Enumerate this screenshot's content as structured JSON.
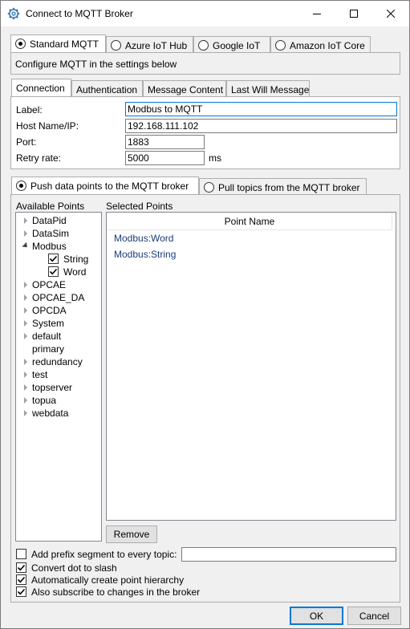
{
  "window": {
    "title": "Connect to MQTT Broker",
    "icon": "gear-icon",
    "controls": [
      "minimize-icon",
      "maximize-icon",
      "close-icon"
    ]
  },
  "broker_tabs": [
    {
      "label": "Standard MQTT",
      "selected": true
    },
    {
      "label": "Azure IoT Hub",
      "selected": false
    },
    {
      "label": "Google IoT",
      "selected": false
    },
    {
      "label": "Amazon IoT Core",
      "selected": false
    }
  ],
  "broker_description": "Configure MQTT in the settings below",
  "settings_tabs": [
    {
      "label": "Connection",
      "active": true
    },
    {
      "label": "Authentication",
      "active": false
    },
    {
      "label": "Message Content",
      "active": false
    },
    {
      "label": "Last Will Message",
      "active": false
    }
  ],
  "connection": {
    "label_caption": "Label:",
    "label_value": "Modbus to MQTT",
    "host_caption": "Host Name/IP:",
    "host_value": "192.168.111.102",
    "port_caption": "Port:",
    "port_value": "1883",
    "retry_caption": "Retry rate:",
    "retry_value": "5000",
    "retry_unit": "ms"
  },
  "direction_tabs": [
    {
      "label": "Push data points to the MQTT broker",
      "selected": true
    },
    {
      "label": "Pull topics from the MQTT broker",
      "selected": false
    }
  ],
  "available_points": {
    "title": "Available Points",
    "tree": [
      {
        "label": "DataPid",
        "expandable": true
      },
      {
        "label": "DataSim",
        "expandable": true
      },
      {
        "label": "Modbus",
        "expanded": true,
        "children": [
          {
            "label": "String",
            "checked": true
          },
          {
            "label": "Word",
            "checked": true
          }
        ]
      },
      {
        "label": "OPCAE",
        "expandable": true
      },
      {
        "label": "OPCAE_DA",
        "expandable": true
      },
      {
        "label": "OPCDA",
        "expandable": true
      },
      {
        "label": "System",
        "expandable": true
      },
      {
        "label": "default",
        "expandable": true
      },
      {
        "label": "primary",
        "expandable": false
      },
      {
        "label": "redundancy",
        "expandable": true
      },
      {
        "label": "test",
        "expandable": true
      },
      {
        "label": "topserver",
        "expandable": true
      },
      {
        "label": "topua",
        "expandable": true
      },
      {
        "label": "webdata",
        "expandable": true
      }
    ]
  },
  "selected_points": {
    "title": "Selected Points",
    "column_header": "Point Name",
    "items": [
      "Modbus:Word",
      "Modbus:String"
    ],
    "remove_label": "Remove"
  },
  "options": {
    "prefix": {
      "label": "Add prefix segment to every topic:",
      "checked": false,
      "value": ""
    },
    "dot_to_slash": {
      "label": "Convert dot to slash",
      "checked": true
    },
    "hierarchy": {
      "label": "Automatically create point hierarchy",
      "checked": true
    },
    "subscribe": {
      "label": "Also subscribe to changes in the broker",
      "checked": true
    }
  },
  "footer": {
    "ok_label": "OK",
    "cancel_label": "Cancel"
  }
}
